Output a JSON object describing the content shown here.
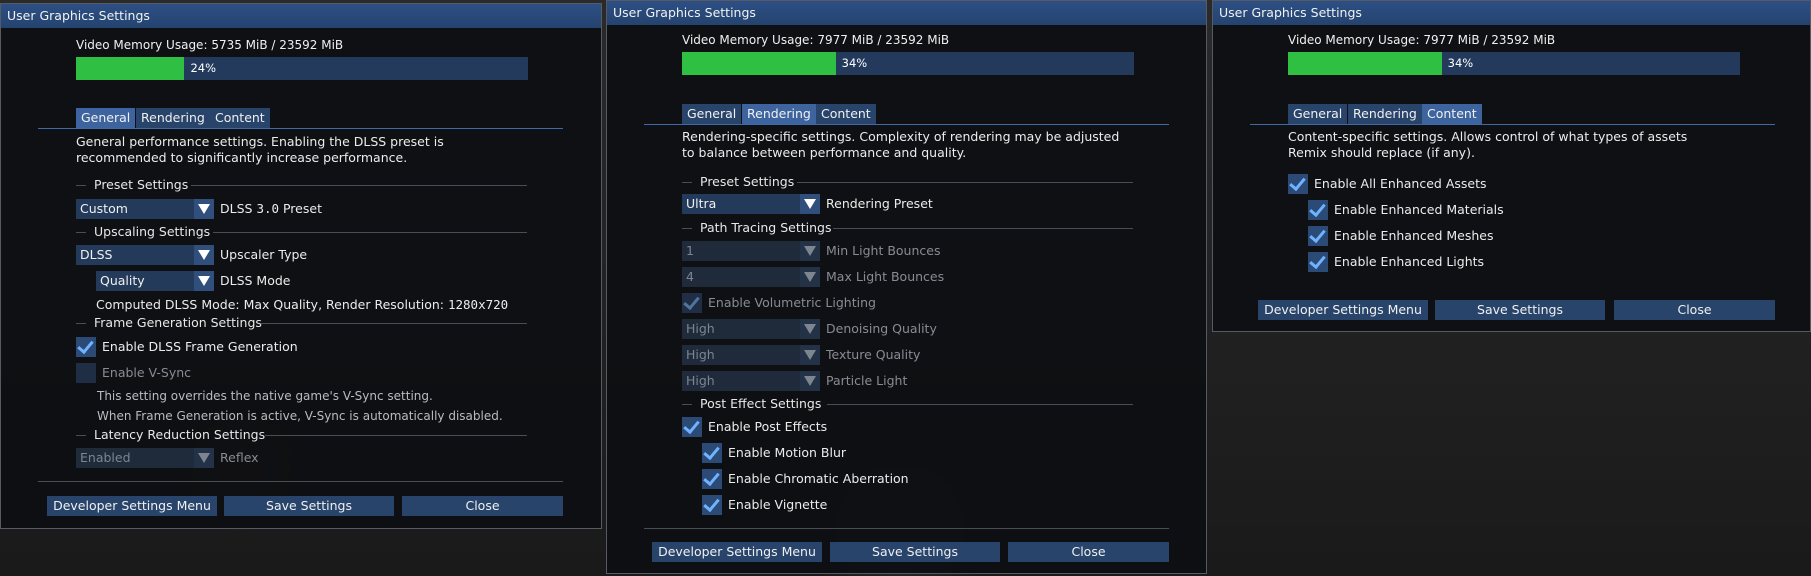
{
  "window1": {
    "title": "User Graphics Settings",
    "memory": {
      "label": "Video Memory Usage:",
      "value": "5735 MiB / 23592 MiB",
      "percent_text": "24%",
      "fraction": 0.24
    },
    "tabs": [
      "General",
      "Rendering",
      "Content"
    ],
    "active_tab": "General",
    "description": "General performance settings. Enabling the DLSS preset is recommended to significantly increase performance.",
    "preset_header": "Preset Settings",
    "preset_value": "Custom",
    "preset_label_a": "DLSS ",
    "preset_label_ver": "3.0",
    "preset_label_b": " Preset",
    "upscaling_header": "Upscaling Settings",
    "upscaler_value": "DLSS",
    "upscaler_label": "Upscaler Type",
    "dlss_mode_value": "Quality",
    "dlss_mode_label": "DLSS Mode",
    "computed_text": "Computed DLSS Mode: Max Quality, Render Resolution: ",
    "computed_res": "1280x720",
    "framegen_header": "Frame Generation Settings",
    "framegen_label": "Enable DLSS Frame Generation",
    "vsync_label": "Enable V-Sync",
    "vsync_note1": "This setting overrides the native game's V-Sync setting.",
    "vsync_note2": "When Frame Generation is active, V-Sync is automatically disabled.",
    "latency_header": "Latency Reduction Settings",
    "reflex_value": "Enabled",
    "reflex_label": "Reflex",
    "buttons": {
      "dev": "Developer Settings Menu",
      "save": "Save Settings",
      "close": "Close"
    }
  },
  "window2": {
    "title": "User Graphics Settings",
    "memory": {
      "label": "Video Memory Usage:",
      "value": "7977 MiB / 23592 MiB",
      "percent_text": "34%",
      "fraction": 0.34
    },
    "tabs": [
      "General",
      "Rendering",
      "Content"
    ],
    "active_tab": "Rendering",
    "description": "Rendering-specific settings. Complexity of rendering may be adjusted to balance between performance and quality.",
    "preset_header": "Preset Settings",
    "preset_value": "Ultra",
    "preset_label": "Rendering Preset",
    "pt_header": "Path Tracing Settings",
    "min_bounces_value": "1",
    "min_bounces_label": "Min Light Bounces",
    "max_bounces_value": "4",
    "max_bounces_label": "Max Light Bounces",
    "volumetric_label": "Enable Volumetric Lighting",
    "denoise_value": "High",
    "denoise_label": "Denoising Quality",
    "texture_value": "High",
    "texture_label": "Texture Quality",
    "particle_value": "High",
    "particle_label": "Particle Light",
    "post_header": "Post Effect Settings",
    "post_label": "Enable Post Effects",
    "motion_blur_label": "Enable Motion Blur",
    "chromatic_label": "Enable Chromatic Aberration",
    "vignette_label": "Enable Vignette",
    "buttons": {
      "dev": "Developer Settings Menu",
      "save": "Save Settings",
      "close": "Close"
    }
  },
  "window3": {
    "title": "User Graphics Settings",
    "memory": {
      "label": "Video Memory Usage:",
      "value": "7977 MiB / 23592 MiB",
      "percent_text": "34%",
      "fraction": 0.34
    },
    "tabs": [
      "General",
      "Rendering",
      "Content"
    ],
    "active_tab": "Content",
    "description": "Content-specific settings. Allows control of what types of assets Remix should replace (if any).",
    "all_assets_label": "Enable All Enhanced Assets",
    "materials_label": "Enable Enhanced Materials",
    "meshes_label": "Enable Enhanced Meshes",
    "lights_label": "Enable Enhanced Lights",
    "buttons": {
      "dev": "Developer Settings Menu",
      "save": "Save Settings",
      "close": "Close"
    }
  }
}
